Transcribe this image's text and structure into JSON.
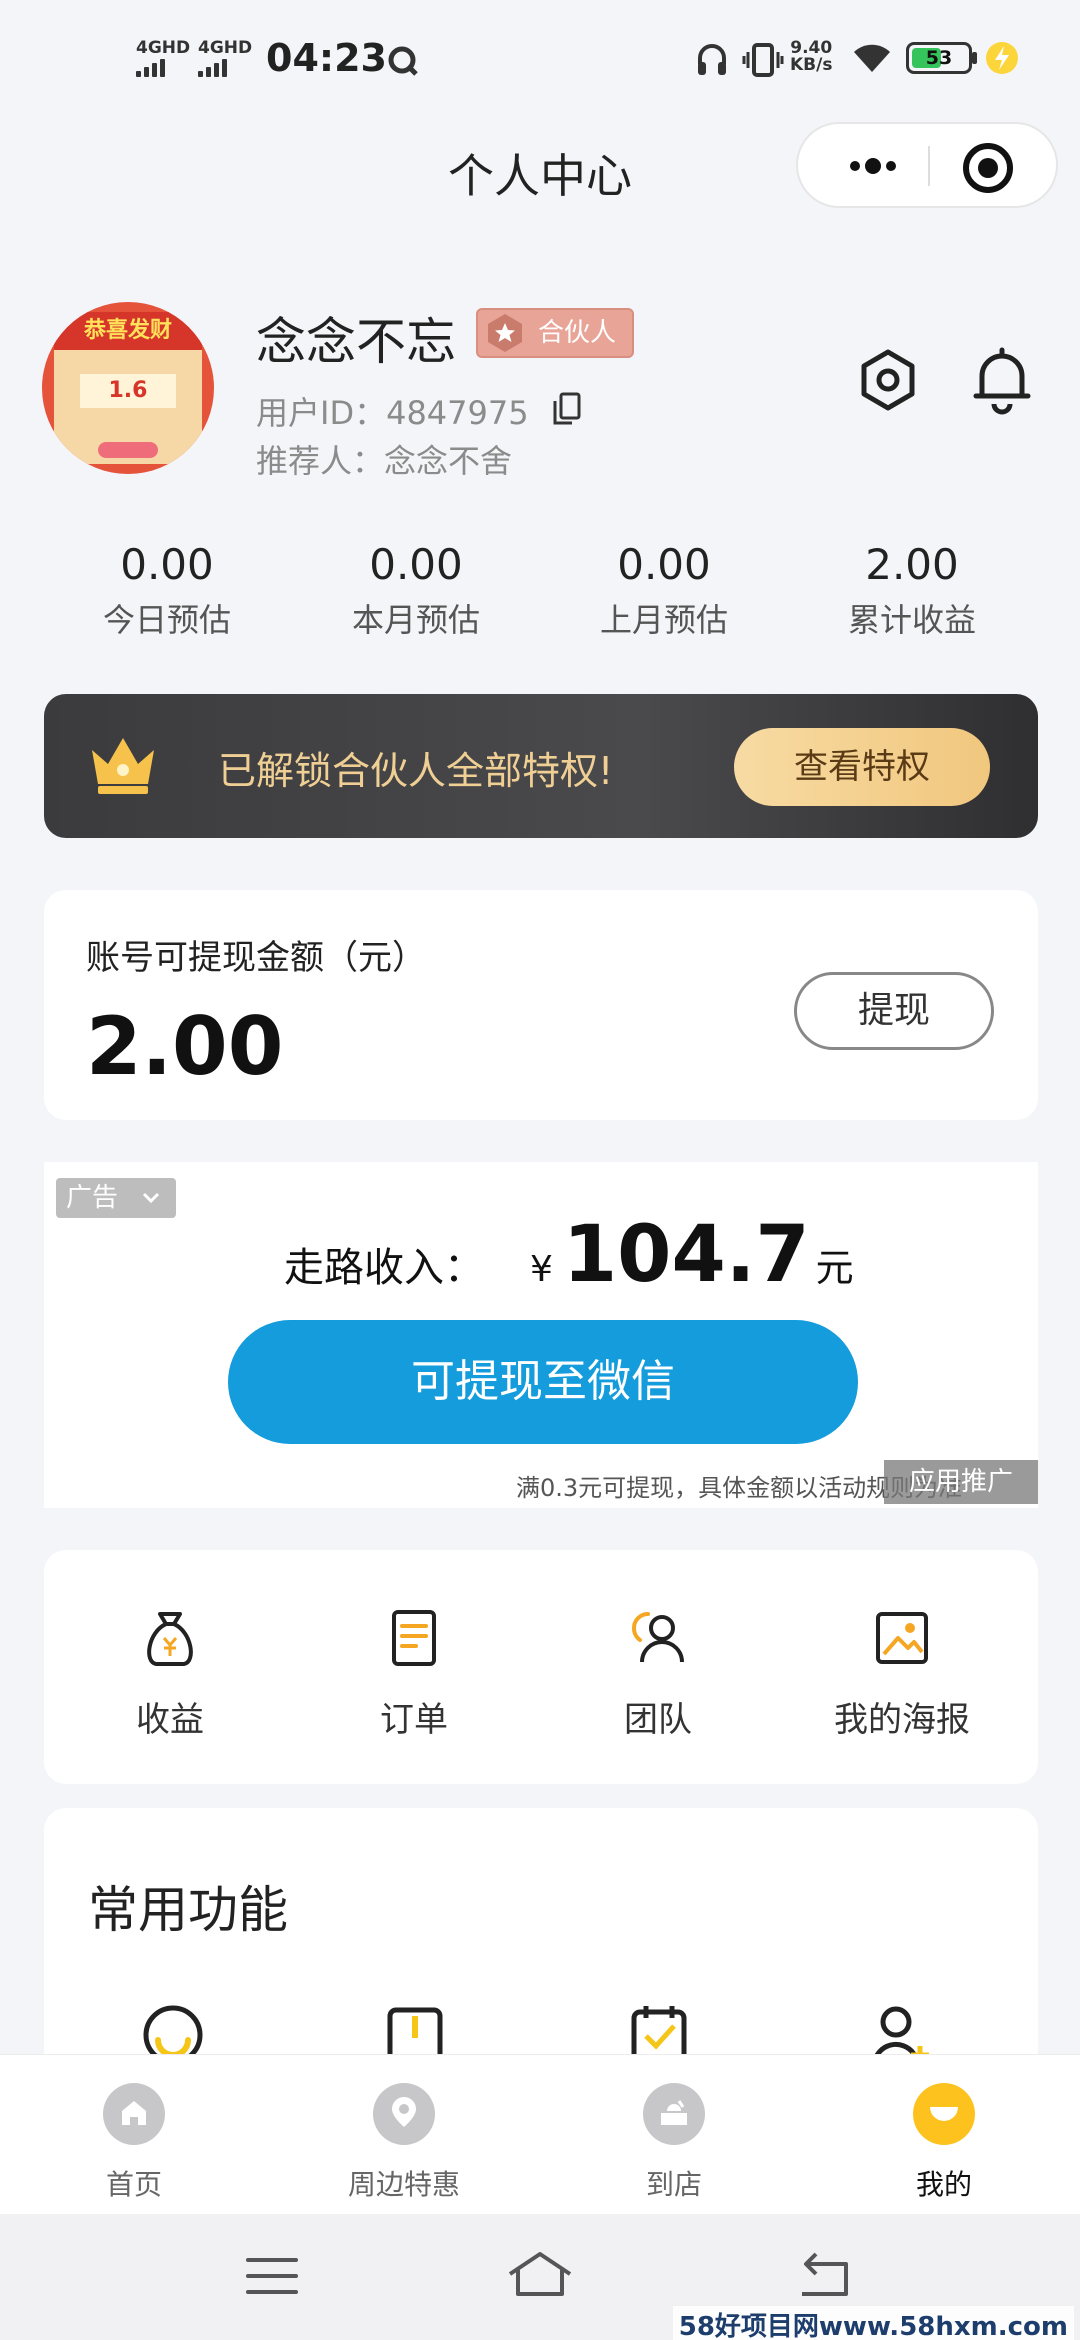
{
  "status_bar": {
    "signal1": "4GHD",
    "signal2": "4GHD",
    "time": "04:23",
    "net_speed_value": "9.40",
    "net_speed_unit": "KB/s",
    "battery": "53",
    "battery_level": 0.53
  },
  "header": {
    "title": "个人中心"
  },
  "profile": {
    "username": "念念不忘",
    "badge": "合伙人",
    "user_id": "用户ID：4847975",
    "referrer": "推荐人：念念不舍",
    "avatar_title": "恭喜发财",
    "avatar_value": "1.6"
  },
  "stats": [
    {
      "value": "0.00",
      "label": "今日预估"
    },
    {
      "value": "0.00",
      "label": "本月预估"
    },
    {
      "value": "0.00",
      "label": "上月预估"
    },
    {
      "value": "2.00",
      "label": "累计收益"
    }
  ],
  "privilege": {
    "text": "已解锁合伙人全部特权!",
    "button": "查看特权"
  },
  "withdraw": {
    "label": "账号可提现金额（元）",
    "amount": "2.00",
    "button": "提现"
  },
  "ad": {
    "tag": "广告",
    "walk_label": "走路收入：",
    "currency": "¥",
    "walk_value": "104.7",
    "walk_unit": "元",
    "button": "可提现至微信",
    "note": "满0.3元可提现，具体金额以活动规则为准",
    "recommend": "应用推广"
  },
  "quick_actions": [
    {
      "label": "收益",
      "icon": "money-bag-icon"
    },
    {
      "label": "订单",
      "icon": "order-icon"
    },
    {
      "label": "团队",
      "icon": "team-icon"
    },
    {
      "label": "我的海报",
      "icon": "poster-icon"
    }
  ],
  "common": {
    "title": "常用功能"
  },
  "bottom_nav": [
    {
      "label": "首页",
      "icon": "home-icon"
    },
    {
      "label": "周边特惠",
      "icon": "location-icon"
    },
    {
      "label": "到店",
      "icon": "store-icon"
    },
    {
      "label": "我的",
      "icon": "profile-smile-icon"
    }
  ],
  "watermark": "58好项目网www.58hxm.com",
  "colors": {
    "accent_yellow": "#fdc21e",
    "wechat_button": "#159cdc",
    "privilege_gold": "#f0cf94"
  }
}
